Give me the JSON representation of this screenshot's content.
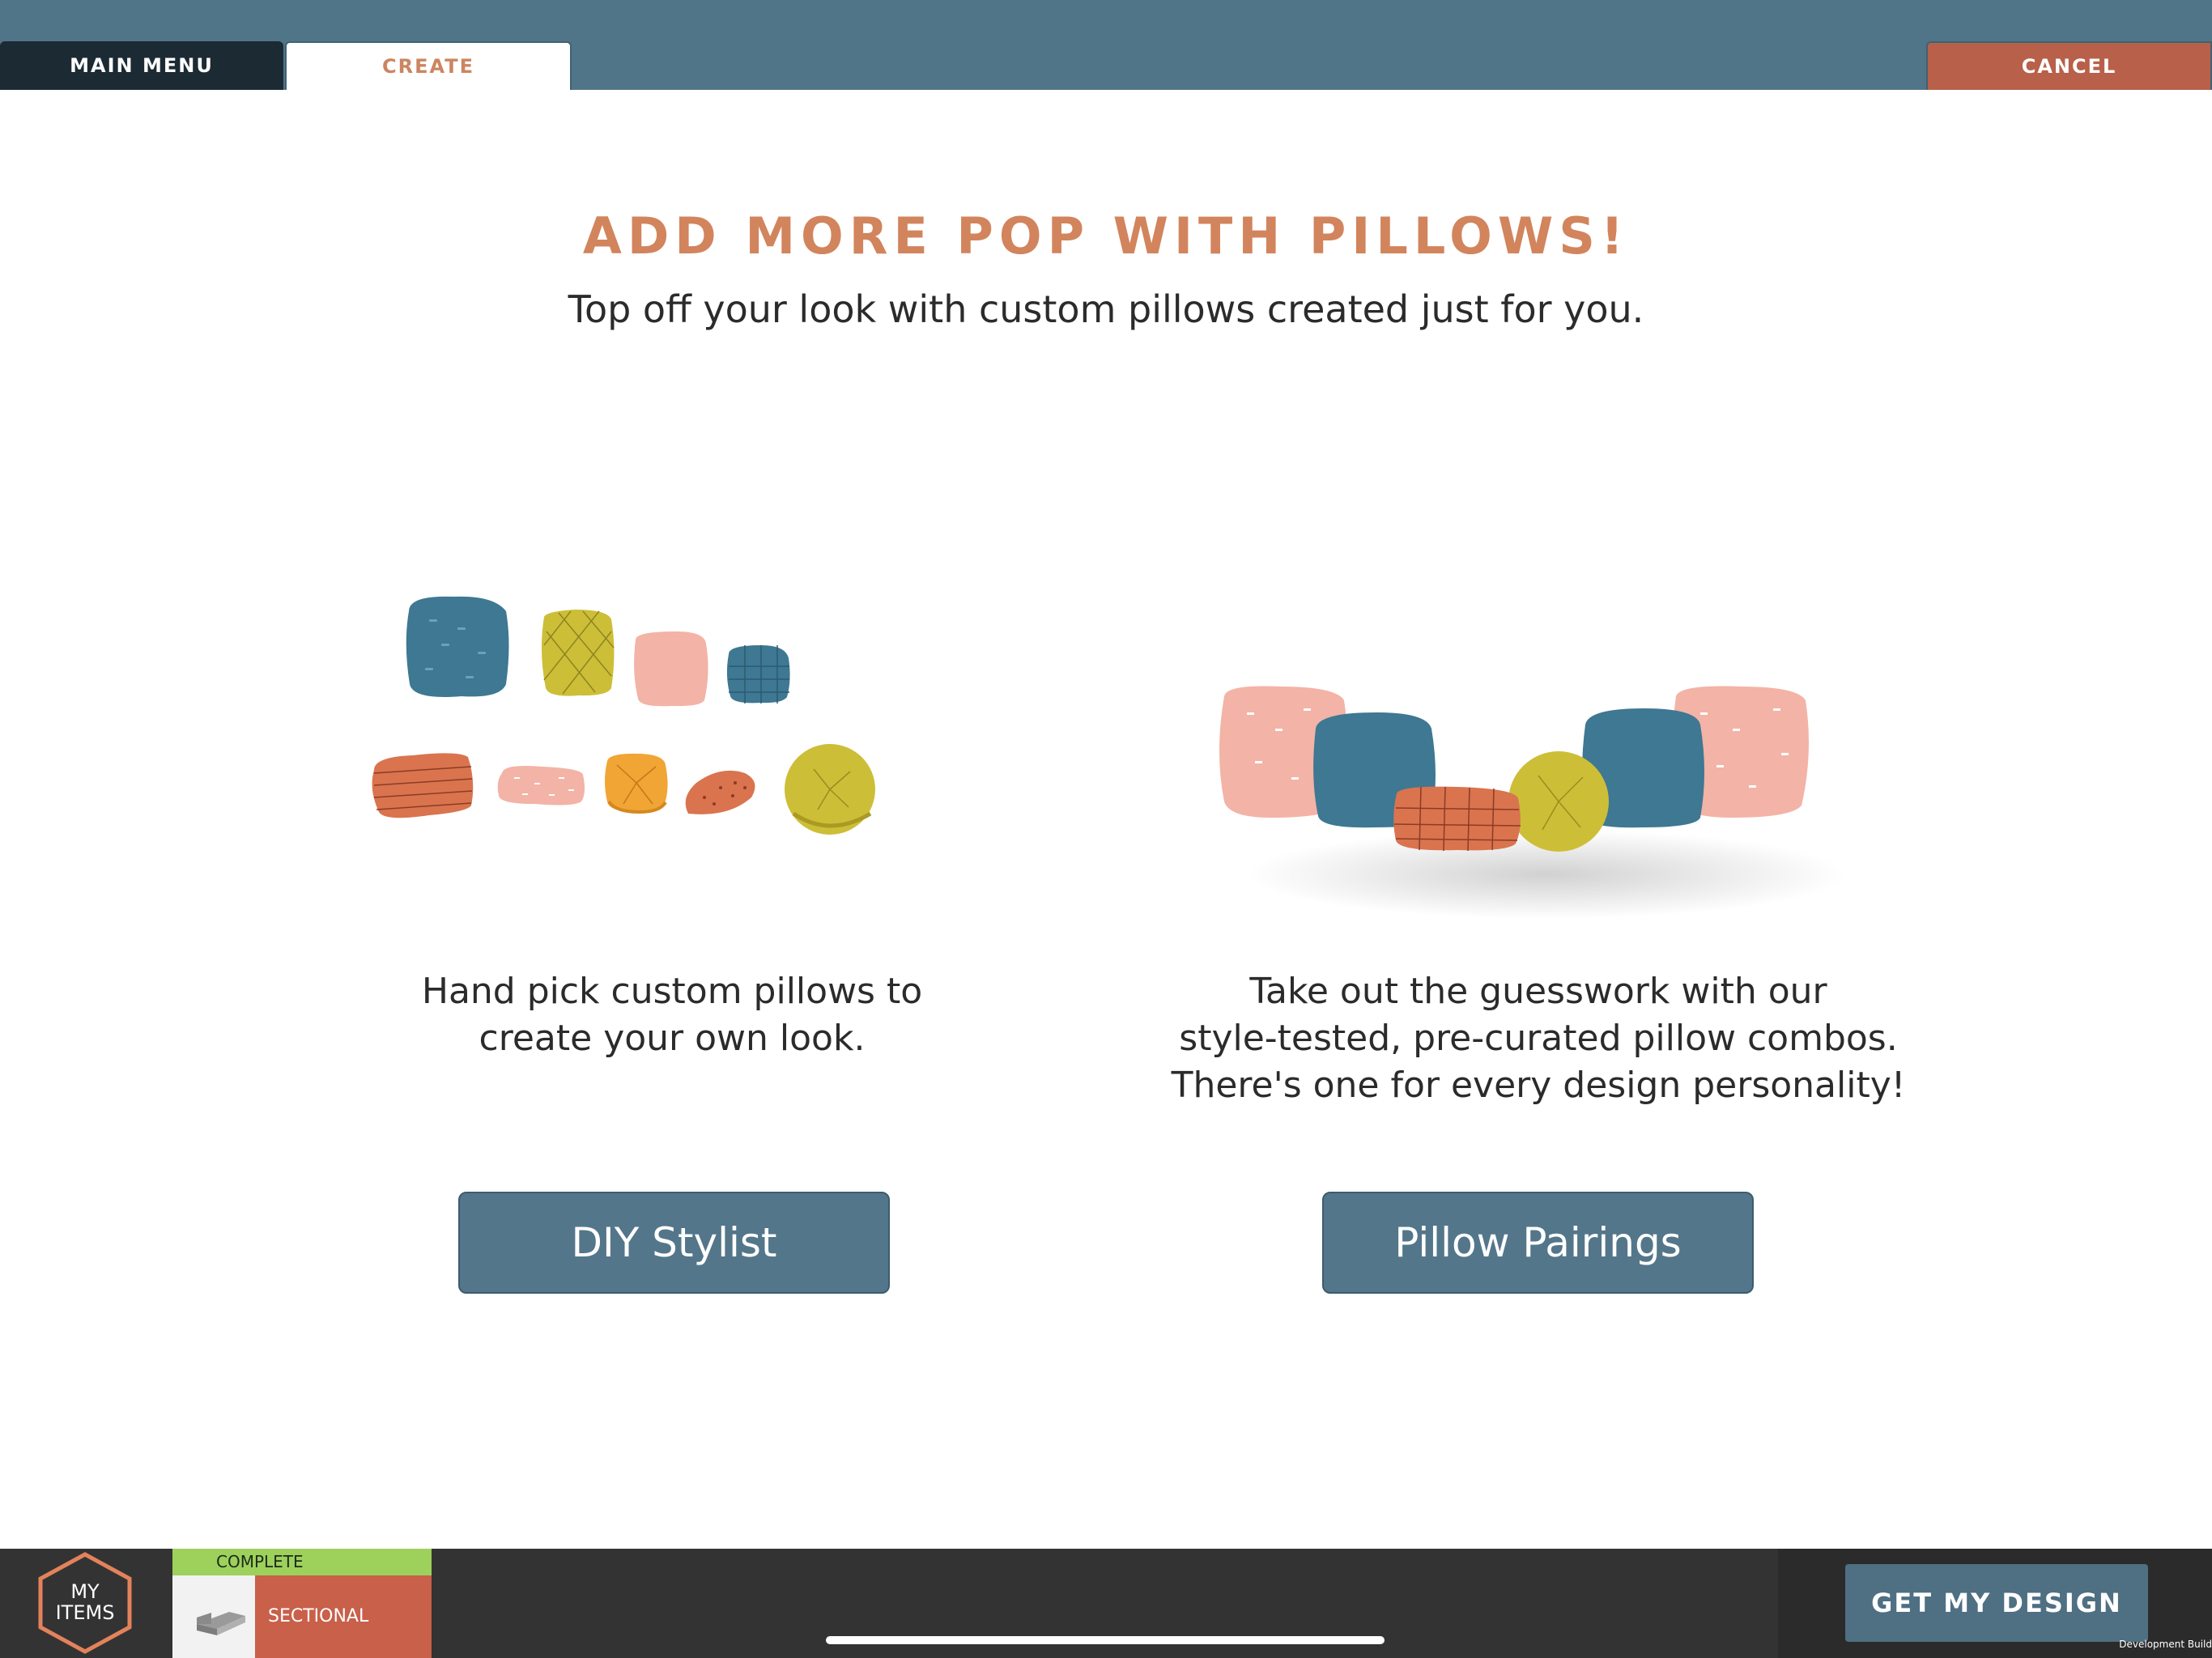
{
  "nav": {
    "main_menu": "MAIN MENU",
    "create": "CREATE",
    "cancel": "CANCEL"
  },
  "page": {
    "title": "ADD MORE POP WITH PILLOWS!",
    "subtitle": "Top off your look with custom pillows created just for you."
  },
  "options": {
    "diy": {
      "lines": [
        "Hand pick custom pillows to",
        "create your own look."
      ],
      "button": "DIY Stylist"
    },
    "pairings": {
      "lines": [
        "Take out the guesswork with our",
        "style-tested, pre-curated pillow combos.",
        "There's one for every design personality!"
      ],
      "button": "Pillow Pairings"
    }
  },
  "footer": {
    "my_items": [
      "MY",
      "ITEMS"
    ],
    "item": {
      "status": "COMPLETE",
      "name": "SECTIONAL"
    },
    "get_design": "GET MY DESIGN",
    "build_label": "Development Build"
  },
  "colors": {
    "top_bar": "#517588",
    "accent_title": "#d2845d",
    "button": "#53768a",
    "cancel": "#b8604a",
    "complete_badge": "#9dd15c",
    "pillow_teal": "#3e7892",
    "pillow_mustard": "#cdbe38",
    "pillow_pink": "#f3b3a6",
    "pillow_terracotta": "#d9744f",
    "pillow_orange": "#f1a535"
  }
}
